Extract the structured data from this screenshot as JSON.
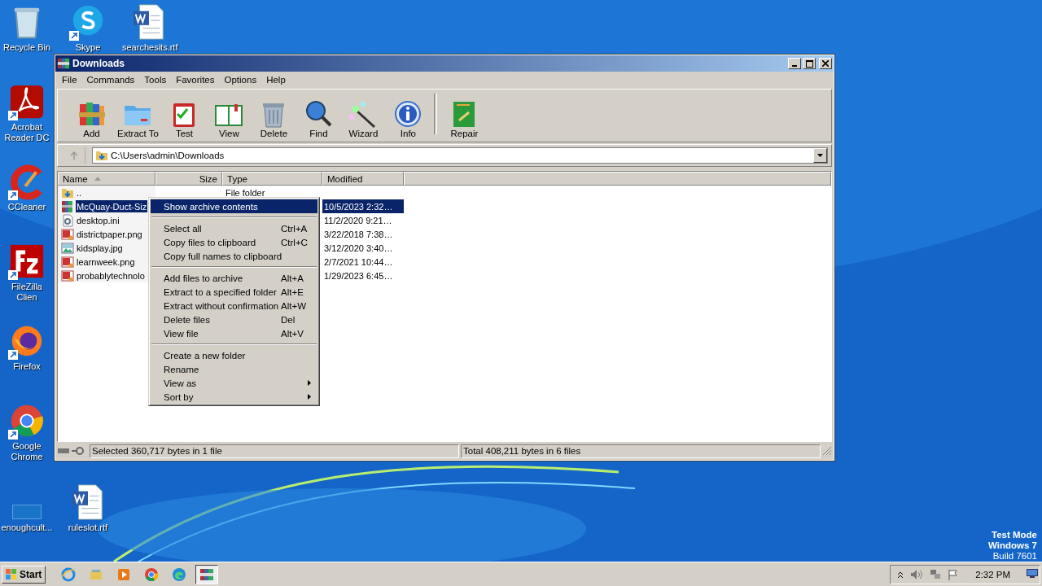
{
  "desktop_icons": [
    {
      "label": "Recycle Bin",
      "kind": "recycle",
      "shortcut": false
    },
    {
      "label": "Skype",
      "kind": "skype",
      "shortcut": true
    },
    {
      "label": "searchesits.rtf",
      "kind": "word",
      "shortcut": false
    },
    {
      "label": "Acrobat Reader DC",
      "kind": "acrobat",
      "shortcut": true
    },
    {
      "label": "CCleaner",
      "kind": "ccleaner",
      "shortcut": true
    },
    {
      "label": "FileZilla Clien",
      "kind": "filezilla",
      "shortcut": true
    },
    {
      "label": "Firefox",
      "kind": "firefox",
      "shortcut": true
    },
    {
      "label": "Google Chrome",
      "kind": "chrome",
      "shortcut": true
    },
    {
      "label": "enoughcult...",
      "kind": "blank",
      "shortcut": false
    },
    {
      "label": "ruleslot.rtf",
      "kind": "word",
      "shortcut": false
    }
  ],
  "window": {
    "title": "Downloads",
    "menu": [
      "File",
      "Commands",
      "Tools",
      "Favorites",
      "Options",
      "Help"
    ],
    "toolbar": [
      {
        "label": "Add",
        "kind": "add"
      },
      {
        "label": "Extract To",
        "kind": "extract"
      },
      {
        "label": "Test",
        "kind": "test"
      },
      {
        "label": "View",
        "kind": "view"
      },
      {
        "label": "Delete",
        "kind": "delete"
      },
      {
        "label": "Find",
        "kind": "find"
      },
      {
        "label": "Wizard",
        "kind": "wizard"
      },
      {
        "label": "Info",
        "kind": "info"
      },
      {
        "label": "Repair",
        "kind": "repair"
      }
    ],
    "address": "C:\\Users\\admin\\Downloads",
    "table": {
      "columns": [
        "Name",
        "Size",
        "Type",
        "Modified"
      ],
      "rows": [
        {
          "kind": "folder",
          "name": "..",
          "type": "File folder",
          "modified": "",
          "selected": false
        },
        {
          "kind": "archive",
          "name": "McQuay-Duct-Siz",
          "type": "",
          "modified": "10/5/2023 2:32…",
          "selected": true
        },
        {
          "kind": "ini",
          "name": "desktop.ini",
          "type": "",
          "modified": "11/2/2020 9:21…",
          "selected": false
        },
        {
          "kind": "png",
          "name": "districtpaper.png",
          "type": "",
          "modified": "3/22/2018 7:38…",
          "selected": false
        },
        {
          "kind": "jpg",
          "name": "kidsplay.jpg",
          "type": "",
          "modified": "3/12/2020 3:40…",
          "selected": false
        },
        {
          "kind": "png",
          "name": "learnweek.png",
          "type": "",
          "modified": "2/7/2021 10:44…",
          "selected": false
        },
        {
          "kind": "png",
          "name": "probablytechnolo",
          "type": "",
          "modified": "1/29/2023 6:45…",
          "selected": false
        }
      ]
    },
    "status_bar": [
      "Selected 360,717 bytes in 1 file",
      "Total 408,211 bytes in 6 files"
    ]
  },
  "context_menu": [
    [
      {
        "label": "Show archive contents",
        "submenu": false,
        "selected": true
      }
    ],
    [
      {
        "label": "Select all",
        "shortcut": "Ctrl+A",
        "submenu": false,
        "selected": false
      },
      {
        "label": "Copy files to clipboard",
        "shortcut": "Ctrl+C",
        "submenu": false,
        "selected": false
      },
      {
        "label": "Copy full names to clipboard",
        "submenu": false,
        "selected": false
      }
    ],
    [
      {
        "label": "Add files to archive",
        "shortcut": "Alt+A",
        "submenu": false,
        "selected": false
      },
      {
        "label": "Extract to a specified folder",
        "shortcut": "Alt+E",
        "submenu": false,
        "selected": false
      },
      {
        "label": "Extract without confirmation",
        "shortcut": "Alt+W",
        "submenu": false,
        "selected": false
      },
      {
        "label": "Delete files",
        "shortcut": "Del",
        "submenu": false,
        "selected": false
      },
      {
        "label": "View file",
        "shortcut": "Alt+V",
        "submenu": false,
        "selected": false
      }
    ],
    [
      {
        "label": "Create a new folder",
        "submenu": false,
        "selected": false
      },
      {
        "label": "Rename",
        "submenu": false,
        "selected": false
      },
      {
        "label": "View as",
        "submenu": true,
        "selected": false
      },
      {
        "label": "Sort by",
        "submenu": true,
        "selected": false
      }
    ]
  ],
  "watermark_text": [
    "Test Mode",
    "Windows 7",
    "Build 7601"
  ],
  "taskbar": {
    "start": "Start",
    "apps": [
      {
        "kind": "ie",
        "selected": false
      },
      {
        "kind": "explorer",
        "selected": false
      },
      {
        "kind": "media",
        "selected": false
      },
      {
        "kind": "chrome",
        "selected": false
      },
      {
        "kind": "edge",
        "selected": false
      },
      {
        "kind": "winrar",
        "selected": true
      }
    ],
    "clock": "2:32 PM"
  }
}
